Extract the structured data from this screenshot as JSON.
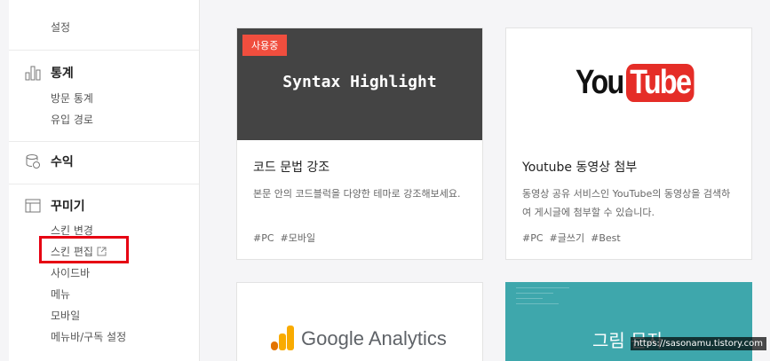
{
  "sidebar": {
    "settings_label": "설정",
    "stats": {
      "title": "통계",
      "icon": "bar-chart-icon",
      "items": [
        "방문 통계",
        "유입 경로"
      ]
    },
    "revenue": {
      "title": "수익",
      "icon": "coins-icon"
    },
    "decorate": {
      "title": "꾸미기",
      "icon": "layout-icon",
      "items": [
        "스킨 변경",
        "스킨 편집",
        "사이드바",
        "메뉴",
        "모바일",
        "메뉴바/구독 설정"
      ]
    }
  },
  "cards": [
    {
      "badge": "사용중",
      "thumb_text": "Syntax Highlight",
      "title": "코드 문법 강조",
      "desc": "본문 안의 코드블럭을 다양한 테마로 강조해보세요.",
      "tags": [
        "#PC",
        "#모바일"
      ]
    },
    {
      "logo": {
        "you": "You",
        "tube": "Tube"
      },
      "title": "Youtube 동영상 첨부",
      "desc": "동영상 공유 서비스인 YouTube의 동영상을 검색하여 게시글에 첨부할 수 있습니다.",
      "tags": [
        "#PC",
        "#글쓰기",
        "#Best"
      ]
    },
    {
      "logo_text": "Google Analytics"
    },
    {
      "thumb_text": "그림 문자"
    }
  ],
  "watermark": "https://sasonamu.tistory.com",
  "colors": {
    "badge": "#f04e3e",
    "highlight_box": "#e60012",
    "youtube_red": "#e52d27",
    "teal": "#3ea7ac",
    "dark_thumb": "#444444"
  }
}
